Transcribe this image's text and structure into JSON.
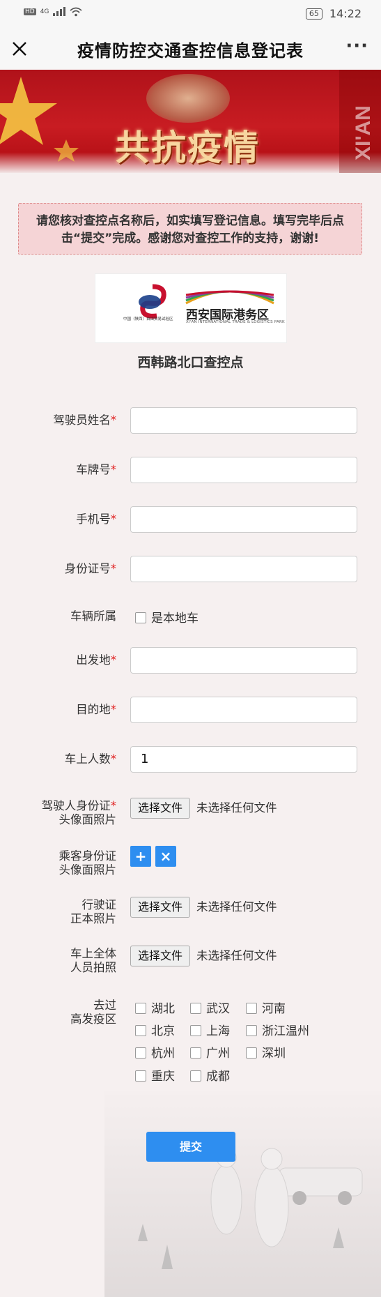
{
  "status_bar": {
    "network": "HD",
    "signal": "4G",
    "battery": "65",
    "time": "14:22"
  },
  "title_bar": {
    "title": "疫情防控交通查控信息登记表",
    "close_icon": "close-icon",
    "more_label": "···"
  },
  "banner": {
    "slogan": "共抗疫情",
    "side_text": "XI'AN"
  },
  "notice": {
    "text": "请您核对查控点名称后，如实填写登记信息。填写完毕后点击“提交”完成。感谢您对查控工作的支持，谢谢!"
  },
  "logo": {
    "brand": "西安国际港务区",
    "brand_en": "XI'AN INTERNATIONAL TRADE & LOGISTICS PARK",
    "emblem_text": "中国（陕西）自由贸易试验区"
  },
  "checkpoint": "西韩路北口查控点",
  "form": {
    "driver_name": {
      "label": "驾驶员姓名",
      "required": "*",
      "value": ""
    },
    "plate": {
      "label": "车牌号",
      "required": "*",
      "value": ""
    },
    "phone": {
      "label": "手机号",
      "required": "*",
      "value": ""
    },
    "id_number": {
      "label": "身份证号",
      "required": "*",
      "value": ""
    },
    "vehicle_owner": {
      "label": "车辆所属",
      "option": "是本地车"
    },
    "origin": {
      "label": "出发地",
      "required": "*",
      "value": ""
    },
    "destination": {
      "label": "目的地",
      "required": "*",
      "value": ""
    },
    "passengers": {
      "label": "车上人数",
      "required": "*",
      "value": "1"
    },
    "driver_id_photo": {
      "label_line1": "驾驶人身份证",
      "label_line2": "头像面照片",
      "required": "*",
      "button": "选择文件",
      "status": "未选择任何文件"
    },
    "passenger_id_photo": {
      "label_line1": "乘客身份证",
      "label_line2": "头像面照片",
      "add": "+",
      "remove": "×"
    },
    "license_photo": {
      "label_line1": "行驶证",
      "label_line2": "正本照片",
      "button": "选择文件",
      "status": "未选择任何文件"
    },
    "group_photo": {
      "label_line1": "车上全体",
      "label_line2": "人员拍照",
      "button": "选择文件",
      "status": "未选择任何文件"
    },
    "high_risk": {
      "label_line1": "去过",
      "label_line2": "高发疫区",
      "options": [
        "湖北",
        "武汉",
        "河南",
        "北京",
        "上海",
        "浙江温州",
        "杭州",
        "广州",
        "深圳",
        "重庆",
        "成都"
      ]
    }
  },
  "submit_label": "提交",
  "colors": {
    "accent": "#2e8ef0",
    "required": "#e02020",
    "notice_bg": "#f5d4d6",
    "banner_red": "#c81c22"
  }
}
